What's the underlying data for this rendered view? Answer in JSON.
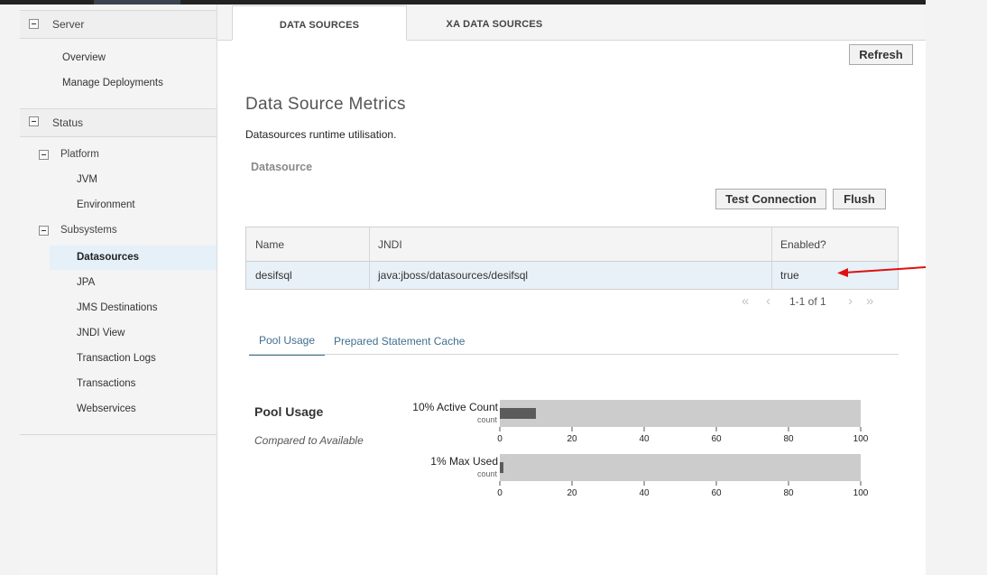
{
  "sidebar": {
    "server": {
      "label": "Server",
      "items": [
        "Overview",
        "Manage Deployments"
      ]
    },
    "status": {
      "label": "Status"
    },
    "platform": {
      "label": "Platform",
      "items": [
        "JVM",
        "Environment"
      ]
    },
    "subsystems": {
      "label": "Subsystems",
      "items": [
        "Datasources",
        "JPA",
        "JMS Destinations",
        "JNDI View",
        "Transaction Logs",
        "Transactions",
        "Webservices"
      ],
      "selected": "Datasources"
    }
  },
  "tabs": [
    {
      "label": "DATA SOURCES",
      "active": true
    },
    {
      "label": "XA DATA SOURCES",
      "active": false
    }
  ],
  "toolbar": {
    "refresh_label": "Refresh"
  },
  "main": {
    "title": "Data Source Metrics",
    "description": "Datasources runtime utilisation.",
    "subtitle": "Datasource",
    "test_connection_label": "Test Connection",
    "flush_label": "Flush"
  },
  "table": {
    "headers": [
      "Name",
      "JNDI",
      "Enabled?"
    ],
    "rows": [
      [
        "desifsql",
        "java:jboss/datasources/desifsql",
        "true"
      ]
    ]
  },
  "pager": {
    "text": "1-1 of 1"
  },
  "subtabs": [
    {
      "label": "Pool Usage",
      "active": true
    },
    {
      "label": "Prepared Statement Cache",
      "active": false
    }
  ],
  "pool": {
    "title": "Pool Usage",
    "subtitle": "Compared to Available"
  },
  "chart_data": {
    "type": "bar",
    "orientation": "horizontal",
    "series": [
      {
        "name": "10% Active Count",
        "unit": "count",
        "value": 10
      },
      {
        "name": "1% Max Used",
        "unit": "count",
        "value": 1
      }
    ],
    "xlim": [
      0,
      100
    ],
    "ticks": [
      0,
      20,
      40,
      60,
      80,
      100
    ]
  },
  "colors": {
    "selected_bg": "#e6f0f8",
    "bar_track": "#cccccc",
    "bar_fill": "#5b5b5b",
    "link": "#3f6f8f",
    "annotation_arrow": "#e01010"
  },
  "icons": {
    "collapse": "minus-square-icon",
    "pager_first": "double-chevron-left-icon",
    "pager_prev": "chevron-left-icon",
    "pager_next": "chevron-right-icon",
    "pager_last": "double-chevron-right-icon"
  }
}
